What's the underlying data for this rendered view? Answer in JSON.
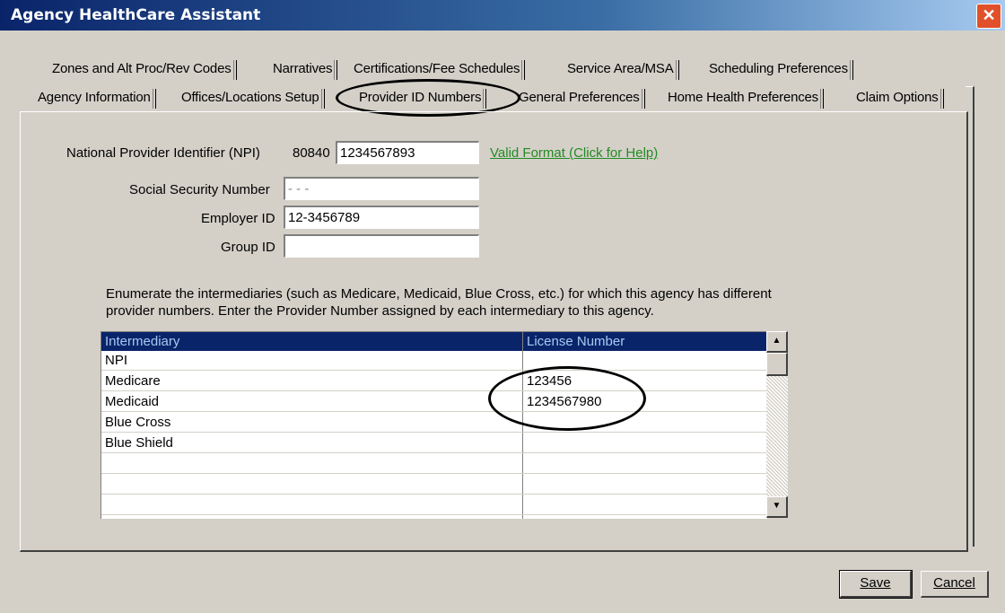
{
  "window": {
    "title": "Agency HealthCare Assistant",
    "close_glyph": "✕"
  },
  "tabs_row1": [
    {
      "label": "Zones and Alt Proc/Rev Codes",
      "ul": "Z"
    },
    {
      "label": "Narratives"
    },
    {
      "label": "Certifications/Fee Schedules"
    },
    {
      "label": "Service Area/MSA"
    },
    {
      "label": "Scheduling Preferences"
    }
  ],
  "tabs_row2": [
    {
      "label": "Agency Information"
    },
    {
      "label": "Offices/Locations Setup"
    },
    {
      "label": "Provider ID Numbers"
    },
    {
      "label": "General Preferences"
    },
    {
      "label": "Home Health Preferences"
    },
    {
      "label": "Claim Options"
    }
  ],
  "form": {
    "npi_label": "National Provider Identifier (NPI)",
    "npi_prefix": "80840",
    "npi_value": "1234567893",
    "npi_link": "Valid Format (Click for Help)",
    "ssn_label": "Social Security Number",
    "ssn_value": "- - -",
    "employer_label": "Employer ID",
    "employer_value": "12-3456789",
    "group_label": "Group ID",
    "group_value": ""
  },
  "instructions": "Enumerate the intermediaries (such as Medicare, Medicaid, Blue Cross, etc.) for which this agency has different provider numbers. Enter the Provider Number assigned by each intermediary to this agency.",
  "grid": {
    "headers": [
      "Intermediary",
      "License Number"
    ],
    "rows": [
      {
        "intermediary": "NPI",
        "license": ""
      },
      {
        "intermediary": "Medicare",
        "license": "123456"
      },
      {
        "intermediary": "Medicaid",
        "license": "1234567980"
      },
      {
        "intermediary": "Blue Cross",
        "license": ""
      },
      {
        "intermediary": "Blue Shield",
        "license": ""
      },
      {
        "intermediary": "",
        "license": ""
      },
      {
        "intermediary": "",
        "license": ""
      },
      {
        "intermediary": "",
        "license": ""
      }
    ]
  },
  "buttons": {
    "save": "Save",
    "cancel": "Cancel"
  },
  "icons": {
    "scroll_up": "up-arrow-icon",
    "scroll_down": "down-arrow-icon"
  },
  "colors": {
    "title_bar": "#0a246a",
    "link": "#228b22",
    "grid_header": "#0a246a"
  }
}
